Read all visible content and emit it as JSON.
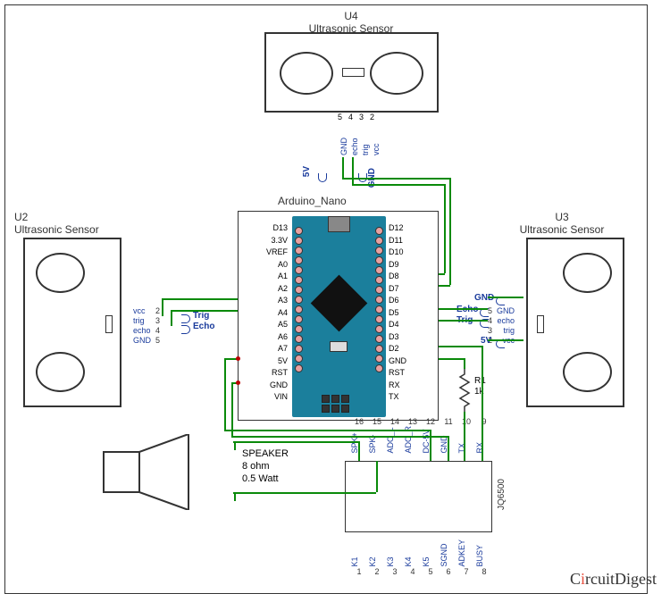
{
  "watermark_prefix": "C",
  "watermark_accent": "i",
  "watermark_rest": "rcuitDigest",
  "sensors": {
    "u2": {
      "ref": "U2",
      "name": "Ultrasonic Sensor",
      "pins": [
        "vcc",
        "trig",
        "echo",
        "GND"
      ],
      "nums": [
        "2",
        "3",
        "4",
        "5"
      ]
    },
    "u3": {
      "ref": "U3",
      "name": "Ultrasonic Sensor",
      "pins": [
        "GND",
        "echo",
        "trig",
        "vcc"
      ],
      "nums": [
        "5",
        "4",
        "3",
        "2"
      ]
    },
    "u4": {
      "ref": "U4",
      "name": "Ultrasonic Sensor",
      "pins": [
        "GND",
        "echo",
        "trig",
        "vcc"
      ],
      "nums": [
        "5",
        "4",
        "3",
        "2"
      ]
    }
  },
  "arduino": {
    "name": "Arduino_Nano",
    "left_pins": [
      "D13",
      "3.3V",
      "VREF",
      "A0",
      "A1",
      "A2",
      "A3",
      "A4",
      "A5",
      "A6",
      "A7",
      "5V",
      "RST",
      "GND",
      "VIN"
    ],
    "right_pins": [
      "D12",
      "D11",
      "D10",
      "D9",
      "D8",
      "D7",
      "D6",
      "D5",
      "D4",
      "D3",
      "D2",
      "GND",
      "RST",
      "RX",
      "TX"
    ]
  },
  "speaker": {
    "label_line1": "SPEAKER",
    "label_line2": "8 ohm",
    "label_line3": "0.5 Watt"
  },
  "jq6500": {
    "name": "JQ6500",
    "top_pins": [
      "SPK+",
      "SPK-",
      "ADC_L",
      "ADC_R",
      "DC-5V",
      "GND",
      "TX",
      "RX"
    ],
    "top_nums": [
      "16",
      "15",
      "14",
      "13",
      "12",
      "11",
      "10",
      "9"
    ],
    "bot_pins": [
      "K1",
      "K2",
      "K3",
      "K4",
      "K5",
      "SGND",
      "ADKEY",
      "BUSY"
    ],
    "bot_nums": [
      "1",
      "2",
      "3",
      "4",
      "5",
      "6",
      "7",
      "8"
    ]
  },
  "resistor": {
    "ref": "R1",
    "value": "1k"
  },
  "netlabels": {
    "u4_5v": "5V",
    "u4_gnd": "GND",
    "u2_trig": "Trig",
    "u2_echo": "Echo",
    "u3_echo": "Echo",
    "u3_trig": "Trig",
    "u3_gnd": "GND",
    "u3_5v": "5V"
  }
}
